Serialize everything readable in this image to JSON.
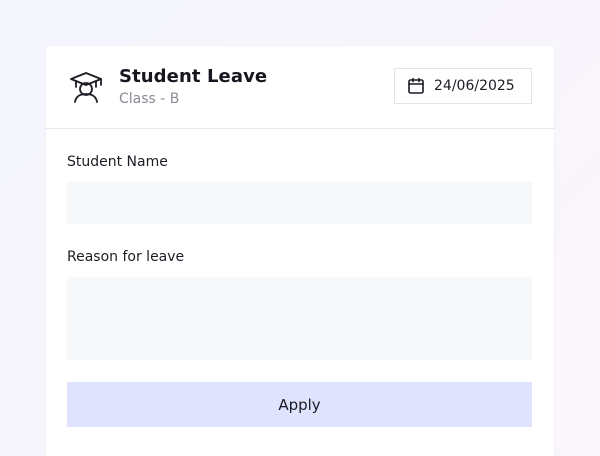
{
  "header": {
    "icon": "graduation-cap-icon",
    "title": "Student Leave",
    "subtitle": "Class - B",
    "date": {
      "icon": "calendar-icon",
      "value": "24/06/2025"
    }
  },
  "form": {
    "student_name": {
      "label": "Student Name",
      "value": "",
      "placeholder": ""
    },
    "reason": {
      "label": "Reason for leave",
      "value": "",
      "placeholder": ""
    },
    "apply_label": "Apply"
  },
  "colors": {
    "field_bg": "#f7f8fa",
    "button_bg": "#e0e3fd",
    "subtitle": "#8a8d96"
  }
}
